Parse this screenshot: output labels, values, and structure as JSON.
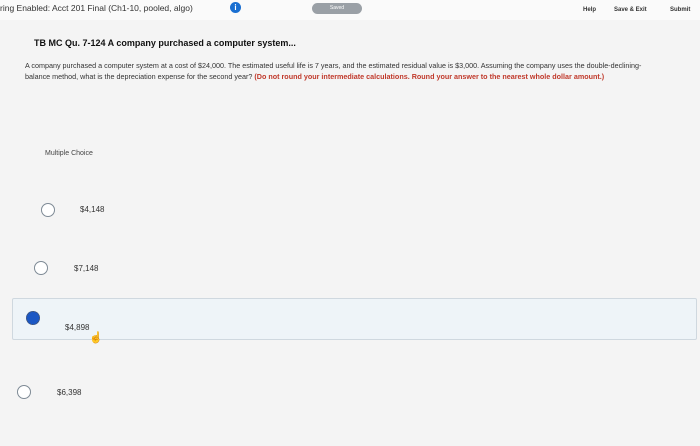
{
  "header": {
    "exam_title": "ring Enabled: Acct 201 Final (Ch1-10, pooled, algo)",
    "status": "Saved",
    "help_label": "Help",
    "save_exit_label": "Save & Exit",
    "submit_label": "Submit"
  },
  "question": {
    "title": "TB MC Qu. 7-124 A company purchased a computer system...",
    "body": "A company purchased a computer system at a cost of $24,000. The estimated useful life is 7 years, and the estimated residual value is $3,000. Assuming the company uses the double-declining-balance method, what is the depreciation expense for the second year?",
    "instruction": "(Do not round your intermediate calculations. Round your answer to the nearest whole dollar amount.)",
    "format_label": "Multiple Choice"
  },
  "options": [
    {
      "label": "$4,148",
      "selected": false
    },
    {
      "label": "$7,148",
      "selected": false
    },
    {
      "label": "$4,898",
      "selected": true
    },
    {
      "label": "$6,398",
      "selected": false
    }
  ]
}
